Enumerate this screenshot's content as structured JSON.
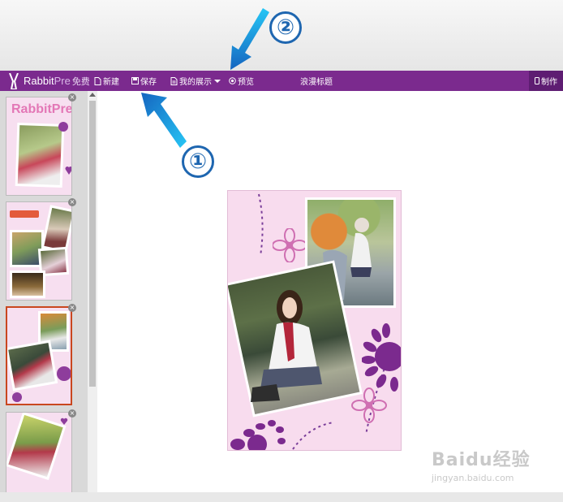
{
  "toolbar": {
    "brand_main": "Rabbit",
    "brand_pre": "Pre",
    "brand_free": "免费",
    "new_label": "新建",
    "save_label": "保存",
    "mine_label": "我的展示",
    "preview_label": "预览",
    "title_label": "浪漫标题",
    "make_label": "制作"
  },
  "annotations": {
    "step1": "①",
    "step2": "②"
  },
  "sidebar": {
    "thumb1_text": "RabbitPre",
    "close_symbol": "×",
    "selected_index": 3
  },
  "colors": {
    "toolbar": "#7b2a8e",
    "accent_arrow": "#1e88e5",
    "card_bg": "#f8dcee",
    "selected_border": "#c9471f"
  },
  "watermark": {
    "main": "Baidu经验",
    "url": "jingyan.baidu.com"
  }
}
